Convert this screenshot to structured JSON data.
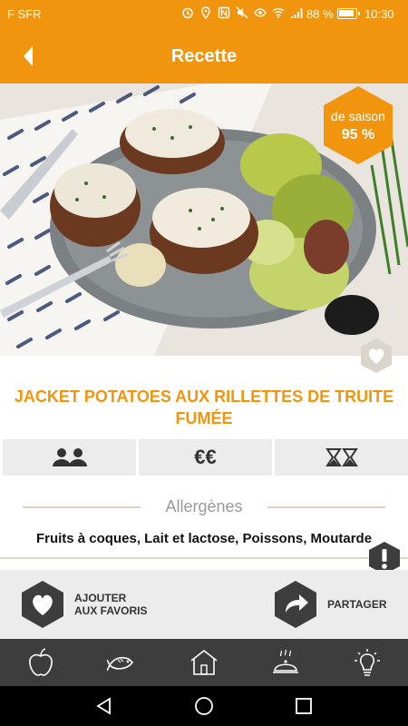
{
  "status_bar": {
    "carrier": "F SFR",
    "battery_percent": "88 %",
    "time": "10:30"
  },
  "app_bar": {
    "title": "Recette",
    "back_icon": "chevron-left-icon"
  },
  "hero": {
    "season_label": "de saison",
    "season_value": "95 %"
  },
  "recipe": {
    "title": "JACKET POTATOES AUX RILLETTES DE TRUITE FUMÉE",
    "price": "€€",
    "icons": [
      "two-persons-icon",
      "euro-icon",
      "hourglass-icon"
    ]
  },
  "allergens": {
    "heading": "Allergènes",
    "list": "Fruits à coques, Lait et lactose, Poissons, Moutarde"
  },
  "actions": {
    "favorite_line1": "AJOUTER",
    "favorite_line2": "AUX FAVORIS",
    "share": "PARTAGER"
  },
  "tabs": [
    {
      "icon": "apple-icon"
    },
    {
      "icon": "fish-icon"
    },
    {
      "icon": "house-icon"
    },
    {
      "icon": "dish-cloche-icon"
    },
    {
      "icon": "lightbulb-icon"
    }
  ],
  "colors": {
    "accent": "#f2950e",
    "tabbar": "#3d3d3d",
    "panel": "#ececec"
  }
}
